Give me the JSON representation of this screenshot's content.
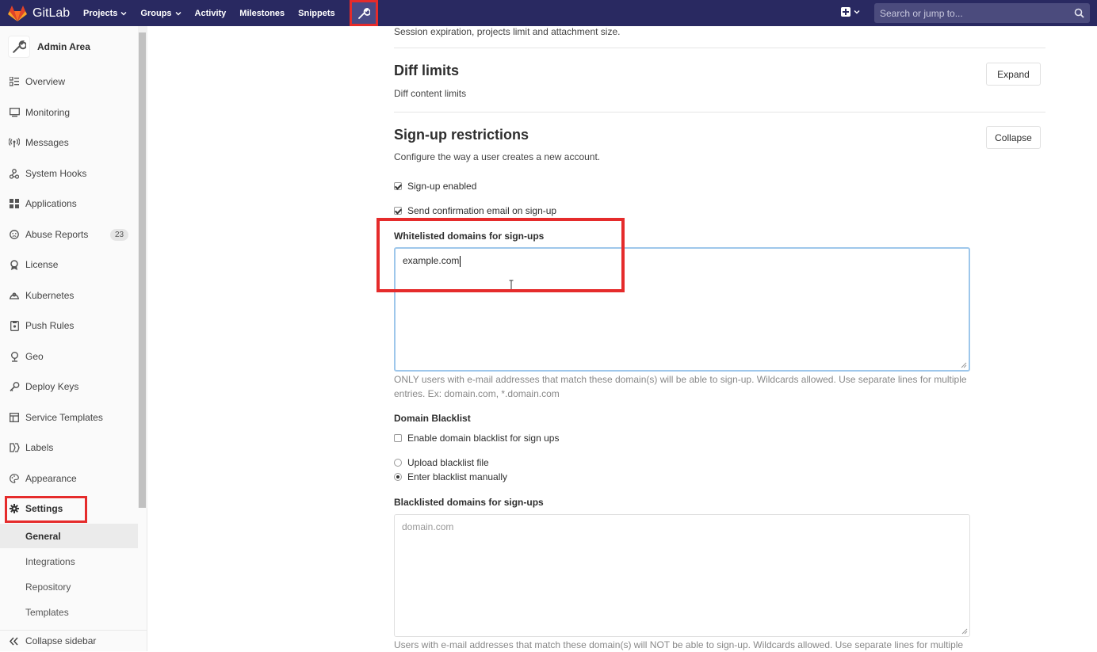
{
  "colors": {
    "navbar": "#292961",
    "highlight": "#e52b2b",
    "focus": "#9ec7eb"
  },
  "navbar": {
    "brand": "GitLab",
    "items": [
      {
        "label": "Projects",
        "has_dropdown": true
      },
      {
        "label": "Groups",
        "has_dropdown": true
      },
      {
        "label": "Activity",
        "has_dropdown": false
      },
      {
        "label": "Milestones",
        "has_dropdown": false
      },
      {
        "label": "Snippets",
        "has_dropdown": false
      }
    ],
    "icons": [
      "chart-icon",
      "admin-wrench-icon",
      "plus-square-icon",
      "search-icon"
    ],
    "search_placeholder": "Search or jump to..."
  },
  "sidebar": {
    "title": "Admin Area",
    "items": [
      {
        "label": "Overview",
        "icon": "overview-icon"
      },
      {
        "label": "Monitoring",
        "icon": "monitor-icon"
      },
      {
        "label": "Messages",
        "icon": "broadcast-icon"
      },
      {
        "label": "System Hooks",
        "icon": "hook-icon"
      },
      {
        "label": "Applications",
        "icon": "apps-icon"
      },
      {
        "label": "Abuse Reports",
        "icon": "abuse-icon",
        "badge": "23"
      },
      {
        "label": "License",
        "icon": "license-icon"
      },
      {
        "label": "Kubernetes",
        "icon": "kubernetes-icon"
      },
      {
        "label": "Push Rules",
        "icon": "push-rules-icon"
      },
      {
        "label": "Geo",
        "icon": "geo-icon"
      },
      {
        "label": "Deploy Keys",
        "icon": "key-icon"
      },
      {
        "label": "Service Templates",
        "icon": "template-icon"
      },
      {
        "label": "Labels",
        "icon": "labels-icon"
      },
      {
        "label": "Appearance",
        "icon": "palette-icon"
      },
      {
        "label": "Settings",
        "icon": "gear-icon"
      }
    ],
    "settings_sub": [
      "General",
      "Integrations",
      "Repository",
      "Templates"
    ],
    "collapse_label": "Collapse sidebar"
  },
  "main": {
    "top_desc": "Session expiration, projects limit and attachment size.",
    "diff": {
      "title": "Diff limits",
      "desc": "Diff content limits",
      "button": "Expand"
    },
    "signup": {
      "title": "Sign-up restrictions",
      "desc": "Configure the way a user creates a new account.",
      "button": "Collapse",
      "signup_enabled": "Sign-up enabled",
      "send_confirmation": "Send confirmation email on sign-up",
      "whitelist_label": "Whitelisted domains for sign-ups",
      "whitelist_value": "example.com",
      "whitelist_help": "ONLY users with e-mail addresses that match these domain(s) will be able to sign-up. Wildcards allowed. Use separate lines for multiple entries. Ex: domain.com, *.domain.com",
      "blacklist_heading": "Domain Blacklist",
      "enable_blacklist": "Enable domain blacklist for sign ups",
      "upload_blacklist": "Upload blacklist file",
      "enter_blacklist": "Enter blacklist manually",
      "blacklisted_label": "Blacklisted domains for sign-ups",
      "blacklisted_placeholder": "domain.com",
      "blacklisted_help": "Users with e-mail addresses that match these domain(s) will NOT be able to sign-up. Wildcards allowed. Use separate lines for multiple"
    }
  }
}
